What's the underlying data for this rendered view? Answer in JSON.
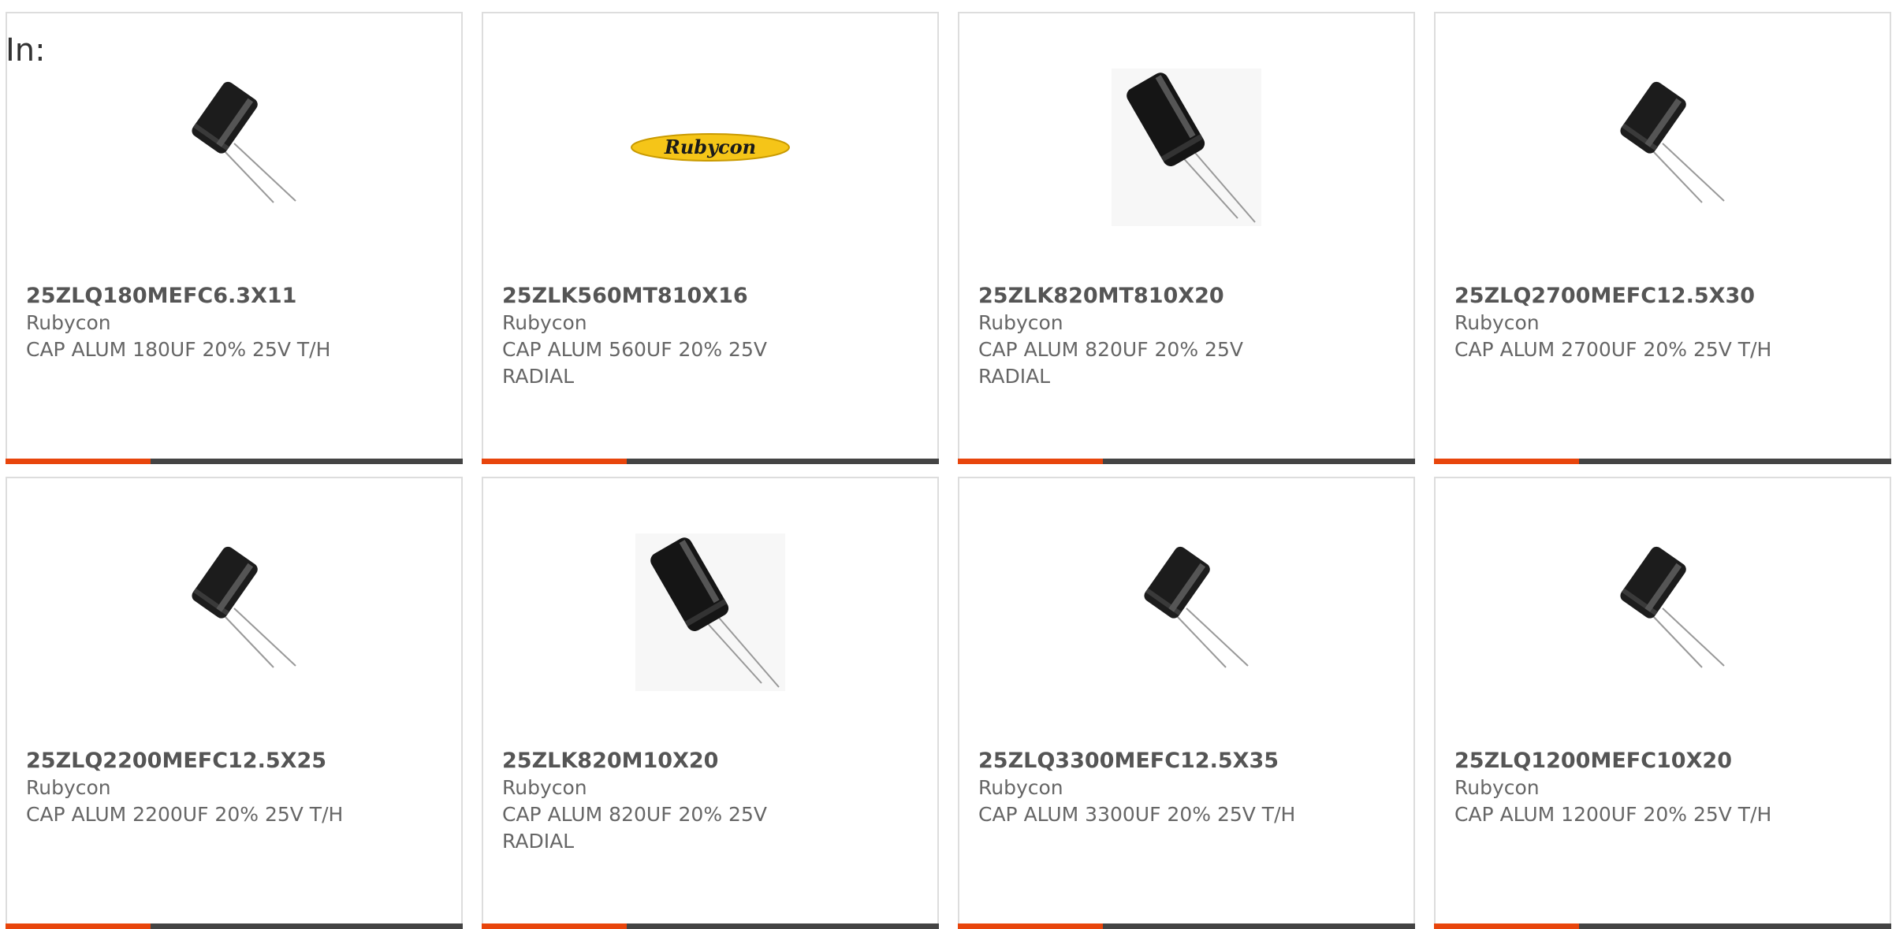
{
  "filter": {
    "label": "In:"
  },
  "colors": {
    "accent": "#e8450c",
    "bar": "#444444",
    "border": "#dddddd",
    "logo_yellow": "#f5c518"
  },
  "products": [
    {
      "part_number": "25ZLQ180MEFC6.3X11",
      "manufacturer": "Rubycon",
      "description": "CAP ALUM 180UF 20% 25V T/H",
      "image": "capacitor-small-icon"
    },
    {
      "part_number": "25ZLK560MT810X16",
      "manufacturer": "Rubycon",
      "description": "CAP ALUM 560UF 20% 25V RADIAL",
      "image": "rubycon-logo",
      "logo_text": "Rubycon"
    },
    {
      "part_number": "25ZLK820MT810X20",
      "manufacturer": "Rubycon",
      "description": "CAP ALUM 820UF 20% 25V RADIAL",
      "image": "capacitor-large-icon"
    },
    {
      "part_number": "25ZLQ2700MEFC12.5X30",
      "manufacturer": "Rubycon",
      "description": "CAP ALUM 2700UF 20% 25V T/H",
      "image": "capacitor-small-icon"
    },
    {
      "part_number": "25ZLQ2200MEFC12.5X25",
      "manufacturer": "Rubycon",
      "description": "CAP ALUM 2200UF 20% 25V T/H",
      "image": "capacitor-small-icon"
    },
    {
      "part_number": "25ZLK820M10X20",
      "manufacturer": "Rubycon",
      "description": "CAP ALUM 820UF 20% 25V RADIAL",
      "image": "capacitor-large-icon"
    },
    {
      "part_number": "25ZLQ3300MEFC12.5X35",
      "manufacturer": "Rubycon",
      "description": "CAP ALUM 3300UF 20% 25V T/H",
      "image": "capacitor-small-icon"
    },
    {
      "part_number": "25ZLQ1200MEFC10X20",
      "manufacturer": "Rubycon",
      "description": "CAP ALUM 1200UF 20% 25V T/H",
      "image": "capacitor-small-icon"
    }
  ]
}
